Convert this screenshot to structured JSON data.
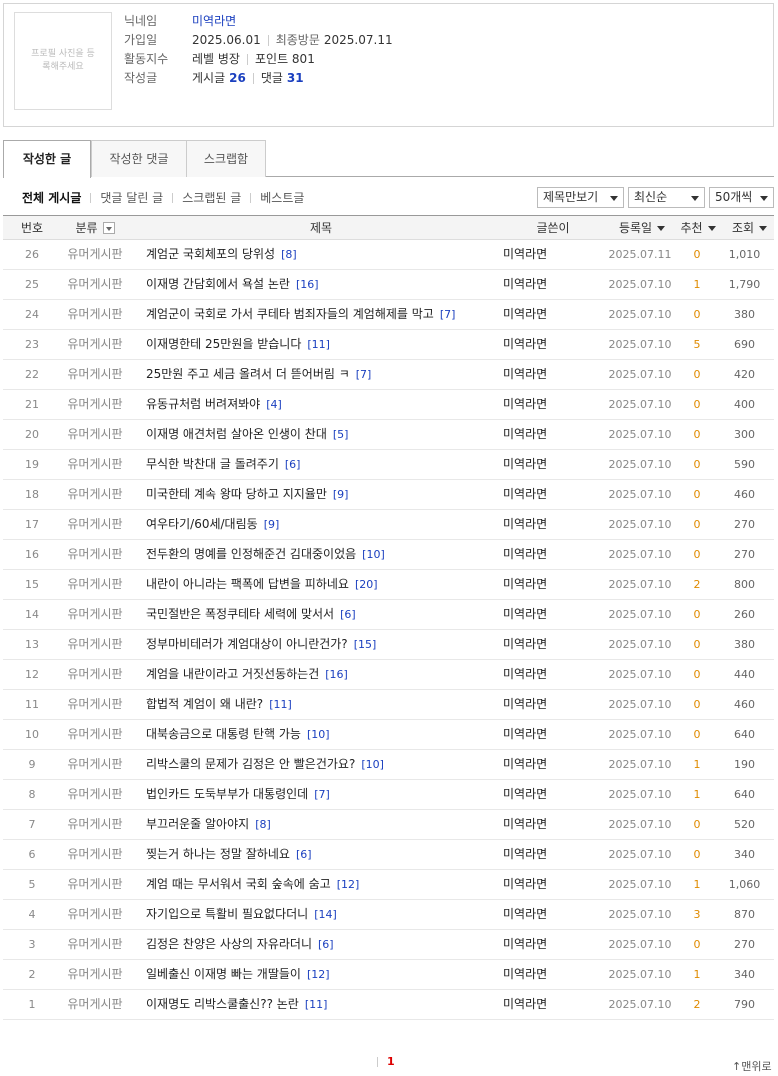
{
  "profile": {
    "photo_text": "프로필 사진을 등록해주세요",
    "nickname_label": "닉네임",
    "nickname": "미역라면",
    "joined_label": "가입일",
    "joined": "2025.06.01",
    "last_visit_label": "최종방문",
    "last_visit": "2025.07.11",
    "activity_label": "활동지수",
    "level": "레벨 병장",
    "points": "포인트 801",
    "written_label": "작성글",
    "posts_label": "게시글",
    "posts_count": "26",
    "comments_label": "댓글",
    "comments_count": "31"
  },
  "tabs": [
    "작성한 글",
    "작성한 댓글",
    "스크랩함"
  ],
  "subnav": [
    "전체 게시글",
    "댓글 달린 글",
    "스크랩된 글",
    "베스트글"
  ],
  "selects": {
    "view_mode": "제목만보기",
    "sort": "최신순",
    "per_page": "50개씩"
  },
  "table": {
    "headers": {
      "num": "번호",
      "category": "분류",
      "title": "제목",
      "author": "글쓴이",
      "date": "등록일",
      "recommend": "추천",
      "views": "조회"
    },
    "rows": [
      {
        "num": "26",
        "category": "유머게시판",
        "title": "계엄군 국회체포의 당위성",
        "comments": "[8]",
        "author": "미역라면",
        "date": "2025.07.11",
        "rec": "0",
        "views": "1,010"
      },
      {
        "num": "25",
        "category": "유머게시판",
        "title": "이재명 간담회에서 욕설 논란",
        "comments": "[16]",
        "author": "미역라면",
        "date": "2025.07.10",
        "rec": "1",
        "views": "1,790"
      },
      {
        "num": "24",
        "category": "유머게시판",
        "title": "계엄군이 국회로 가서 쿠테타 범죄자들의 계엄해제를 막고",
        "comments": "[7]",
        "author": "미역라면",
        "date": "2025.07.10",
        "rec": "0",
        "views": "380"
      },
      {
        "num": "23",
        "category": "유머게시판",
        "title": "이재명한테 25만원을 받습니다",
        "comments": "[11]",
        "author": "미역라면",
        "date": "2025.07.10",
        "rec": "5",
        "views": "690"
      },
      {
        "num": "22",
        "category": "유머게시판",
        "title": "25만원 주고 세금 올려서 더 뜯어버림 ㅋ",
        "comments": "[7]",
        "author": "미역라면",
        "date": "2025.07.10",
        "rec": "0",
        "views": "420"
      },
      {
        "num": "21",
        "category": "유머게시판",
        "title": "유동규처럼 버려져봐야",
        "comments": "[4]",
        "author": "미역라면",
        "date": "2025.07.10",
        "rec": "0",
        "views": "400"
      },
      {
        "num": "20",
        "category": "유머게시판",
        "title": "이재명 애견처럼 살아온 인생이 찬대",
        "comments": "[5]",
        "author": "미역라면",
        "date": "2025.07.10",
        "rec": "0",
        "views": "300"
      },
      {
        "num": "19",
        "category": "유머게시판",
        "title": "무식한 박찬대 글 돌려주기",
        "comments": "[6]",
        "author": "미역라면",
        "date": "2025.07.10",
        "rec": "0",
        "views": "590"
      },
      {
        "num": "18",
        "category": "유머게시판",
        "title": "미국한테 계속 왕따 당하고 지지율만",
        "comments": "[9]",
        "author": "미역라면",
        "date": "2025.07.10",
        "rec": "0",
        "views": "460"
      },
      {
        "num": "17",
        "category": "유머게시판",
        "title": "여우타기/60세/대림동",
        "comments": "[9]",
        "author": "미역라면",
        "date": "2025.07.10",
        "rec": "0",
        "views": "270"
      },
      {
        "num": "16",
        "category": "유머게시판",
        "title": "전두환의 명예를 인정해준건 김대중이었음",
        "comments": "[10]",
        "author": "미역라면",
        "date": "2025.07.10",
        "rec": "0",
        "views": "270"
      },
      {
        "num": "15",
        "category": "유머게시판",
        "title": "내란이 아니라는 팩폭에 답변을 피하네요",
        "comments": "[20]",
        "author": "미역라면",
        "date": "2025.07.10",
        "rec": "2",
        "views": "800"
      },
      {
        "num": "14",
        "category": "유머게시판",
        "title": "국민절반은 폭정쿠테타 세력에 맞서서",
        "comments": "[6]",
        "author": "미역라면",
        "date": "2025.07.10",
        "rec": "0",
        "views": "260"
      },
      {
        "num": "13",
        "category": "유머게시판",
        "title": "정부마비테러가 계엄대상이 아니란건가?",
        "comments": "[15]",
        "author": "미역라면",
        "date": "2025.07.10",
        "rec": "0",
        "views": "380"
      },
      {
        "num": "12",
        "category": "유머게시판",
        "title": "계엄을 내란이라고 거짓선동하는건",
        "comments": "[16]",
        "author": "미역라면",
        "date": "2025.07.10",
        "rec": "0",
        "views": "440"
      },
      {
        "num": "11",
        "category": "유머게시판",
        "title": "합법적 계엄이 왜 내란?",
        "comments": "[11]",
        "author": "미역라면",
        "date": "2025.07.10",
        "rec": "0",
        "views": "460"
      },
      {
        "num": "10",
        "category": "유머게시판",
        "title": "대북송금으로 대통령 탄핵 가능",
        "comments": "[10]",
        "author": "미역라면",
        "date": "2025.07.10",
        "rec": "0",
        "views": "640"
      },
      {
        "num": "9",
        "category": "유머게시판",
        "title": "리박스쿨의 문제가 김정은 안 빨은건가요?",
        "comments": "[10]",
        "author": "미역라면",
        "date": "2025.07.10",
        "rec": "1",
        "views": "190"
      },
      {
        "num": "8",
        "category": "유머게시판",
        "title": "법인카드 도둑부부가 대통령인데",
        "comments": "[7]",
        "author": "미역라면",
        "date": "2025.07.10",
        "rec": "1",
        "views": "640"
      },
      {
        "num": "7",
        "category": "유머게시판",
        "title": "부끄러운줄 알아야지",
        "comments": "[8]",
        "author": "미역라면",
        "date": "2025.07.10",
        "rec": "0",
        "views": "520"
      },
      {
        "num": "6",
        "category": "유머게시판",
        "title": "찢는거 하나는 정말 잘하네요",
        "comments": "[6]",
        "author": "미역라면",
        "date": "2025.07.10",
        "rec": "0",
        "views": "340"
      },
      {
        "num": "5",
        "category": "유머게시판",
        "title": "계엄 때는 무서워서 국회 숲속에 숨고",
        "comments": "[12]",
        "author": "미역라면",
        "date": "2025.07.10",
        "rec": "1",
        "views": "1,060"
      },
      {
        "num": "4",
        "category": "유머게시판",
        "title": "자기입으로 특활비 필요없다더니",
        "comments": "[14]",
        "author": "미역라면",
        "date": "2025.07.10",
        "rec": "3",
        "views": "870"
      },
      {
        "num": "3",
        "category": "유머게시판",
        "title": "김정은 찬양은 사상의 자유라더니",
        "comments": "[6]",
        "author": "미역라면",
        "date": "2025.07.10",
        "rec": "0",
        "views": "270"
      },
      {
        "num": "2",
        "category": "유머게시판",
        "title": "일베출신 이재명 빠는 개딸들이",
        "comments": "[12]",
        "author": "미역라면",
        "date": "2025.07.10",
        "rec": "1",
        "views": "340"
      },
      {
        "num": "1",
        "category": "유머게시판",
        "title": "이재명도 리박스쿨출신?? 논란",
        "comments": "[11]",
        "author": "미역라면",
        "date": "2025.07.10",
        "rec": "2",
        "views": "790"
      }
    ]
  },
  "pagination": {
    "current": "1"
  },
  "to_top": "↑맨위로",
  "colors": {
    "link_blue": "#1a3fbf",
    "recommend_orange": "#e08b00",
    "current_page_red": "#d00000"
  }
}
